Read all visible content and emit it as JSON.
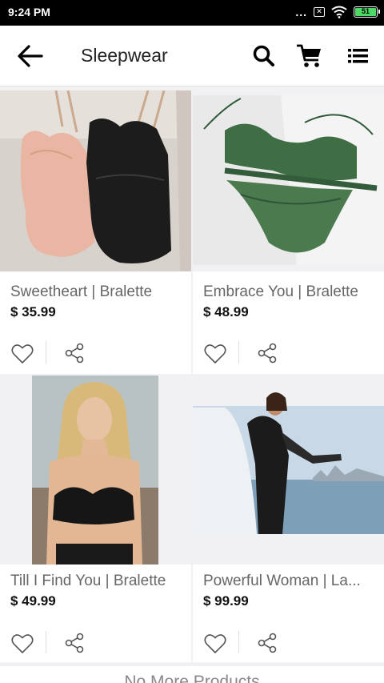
{
  "status_bar": {
    "time": "9:24 PM",
    "dots": "...",
    "battery_level": "51"
  },
  "app_bar": {
    "title": "Sleepwear"
  },
  "products": [
    {
      "name": "Sweetheart | Bralette",
      "price": "$ 35.99",
      "image": "pink-and-black-lace-bralettes-photo"
    },
    {
      "name": "Embrace You | Bralette",
      "price": "$ 48.99",
      "image": "green-lace-lingerie-set-photo"
    },
    {
      "name": "Till I Find You | Bralette",
      "price": "$ 49.99",
      "image": "model-black-lace-bralette-photo"
    },
    {
      "name": "Powerful Woman | La...",
      "price": "$ 99.99",
      "image": "model-black-lace-robe-waterfront-photo"
    }
  ],
  "footer": {
    "text": "No More Products"
  },
  "colors": {
    "background": "#f1f1f3",
    "card": "#ffffff",
    "price_text": "#111111",
    "name_text": "#666666"
  }
}
